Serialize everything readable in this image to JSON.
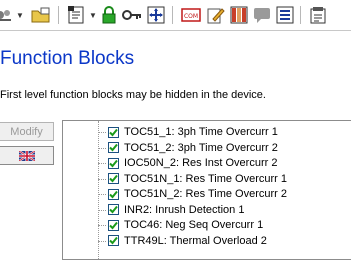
{
  "toolbar": {
    "icons": [
      "network-icon",
      "folder-icon",
      "document-view-icon",
      "lock-icon",
      "key-icon",
      "zoom-fit-icon",
      "com-icon",
      "edit-icon",
      "columns-icon",
      "comment-icon",
      "list-icon",
      "properties-icon"
    ],
    "com_label": "COM"
  },
  "page": {
    "title": "Function Blocks",
    "description": "First level function blocks may be hidden in the device."
  },
  "buttons": {
    "modify_label": "Modify",
    "language_flag": "uk-flag-icon"
  },
  "function_blocks": [
    {
      "label": "TOC51_1: 3ph Time Overcurr 1",
      "checked": true
    },
    {
      "label": "TOC51_2: 3ph Time Overcurr 2",
      "checked": true
    },
    {
      "label": "IOC50N_2: Res Inst Overcurr 2",
      "checked": true
    },
    {
      "label": "TOC51N_1: Res Time Overcurr 1",
      "checked": true
    },
    {
      "label": "TOC51N_2: Res Time Overcurr 2",
      "checked": true
    },
    {
      "label": "INR2: Inrush Detection 1",
      "checked": true
    },
    {
      "label": "TOC46: Neg Seq Overcurr 1",
      "checked": true
    },
    {
      "label": "TTR49L: Thermal Overload 2",
      "checked": true
    }
  ],
  "colors": {
    "heading": "#0b37c8",
    "check": "#1a9a1a"
  }
}
